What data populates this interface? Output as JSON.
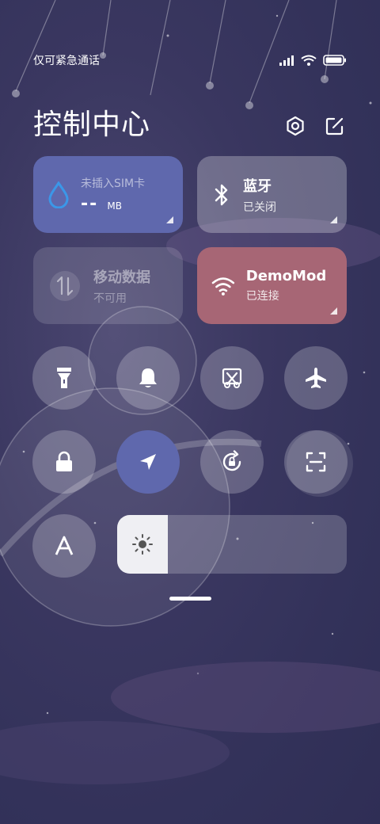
{
  "status": {
    "carrier": "仅可紧急通话",
    "icons": [
      "signal-icon",
      "wifi-icon",
      "battery-icon"
    ]
  },
  "header": {
    "title": "控制中心",
    "icons": [
      "settings-icon",
      "edit-icon"
    ]
  },
  "tiles": {
    "sim": {
      "line1": "未插入SIM卡",
      "value": "--",
      "unit": "MB"
    },
    "bluetooth": {
      "title": "蓝牙",
      "status": "已关闭"
    },
    "mobile_data": {
      "title": "移动数据",
      "status": "不可用"
    },
    "wifi": {
      "title": "DemoMod",
      "status": "已连接"
    }
  },
  "toggles": [
    "flashlight-icon",
    "bell-icon",
    "screenshot-icon",
    "airplane-icon",
    "lock-icon",
    "location-icon",
    "rotation-lock-icon",
    "scan-icon",
    "font-icon"
  ],
  "brightness": {
    "level": 0.22,
    "icon": "sun-icon"
  },
  "colors": {
    "sim_tile": "#5f68ad",
    "wifi_tile": "#a76675",
    "active_toggle": "#5f68ad",
    "sim_icon": "#3b97e8"
  }
}
